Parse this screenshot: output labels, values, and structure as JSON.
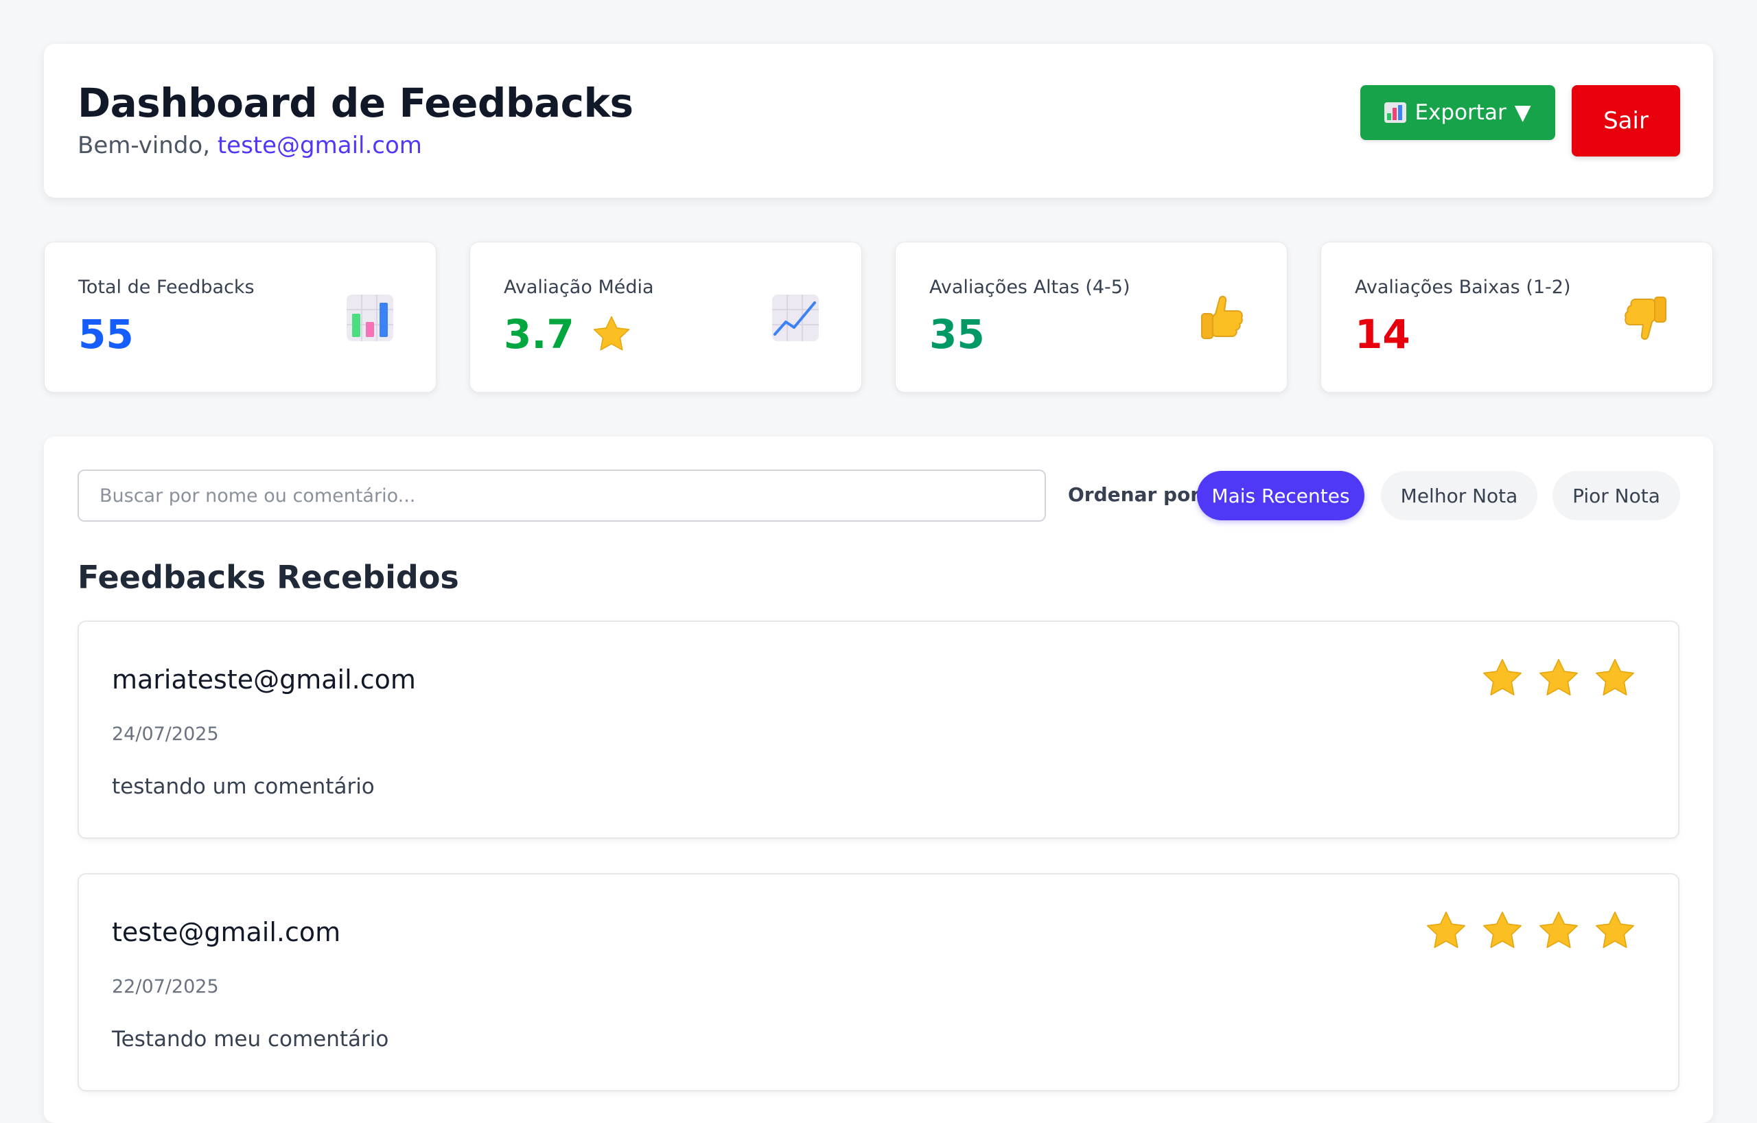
{
  "header": {
    "title": "Dashboard de Feedbacks",
    "welcome_prefix": "Bem-vindo,",
    "user_email": "teste@gmail.com",
    "export_label": "Exportar",
    "export_arrow": "▼",
    "logout_label": "Sair"
  },
  "stats": [
    {
      "label": "Total de Feedbacks",
      "value": "55",
      "icon": "bar-chart-icon",
      "color": "#155dfc"
    },
    {
      "label": "Avaliação Média",
      "value": "3.7",
      "icon": "line-chart-icon",
      "color": "#00a63e"
    },
    {
      "label": "Avaliações Altas (4-5)",
      "value": "35",
      "icon": "thumbs-up-icon",
      "color": "#009966"
    },
    {
      "label": "Avaliações Baixas (1-2)",
      "value": "14",
      "icon": "thumbs-down-icon",
      "color": "#e7000b"
    }
  ],
  "search": {
    "placeholder": "Buscar por nome ou comentário..."
  },
  "sort": {
    "label": "Ordenar por:",
    "options": [
      "Mais Recentes",
      "Melhor Nota",
      "Pior Nota"
    ],
    "selected": "Mais Recentes"
  },
  "feedbacks": {
    "title": "Feedbacks Recebidos",
    "items": [
      {
        "name": "mariateste@gmail.com",
        "date": "24/07/2025",
        "comment": "testando um comentário",
        "rating": 3
      },
      {
        "name": "teste@gmail.com",
        "date": "22/07/2025",
        "comment": "Testando meu comentário",
        "rating": 4
      }
    ]
  },
  "colors": {
    "accent": "#4f39f6",
    "export": "#16a34a",
    "logout": "#e7000b",
    "star": "#fbbf24"
  }
}
